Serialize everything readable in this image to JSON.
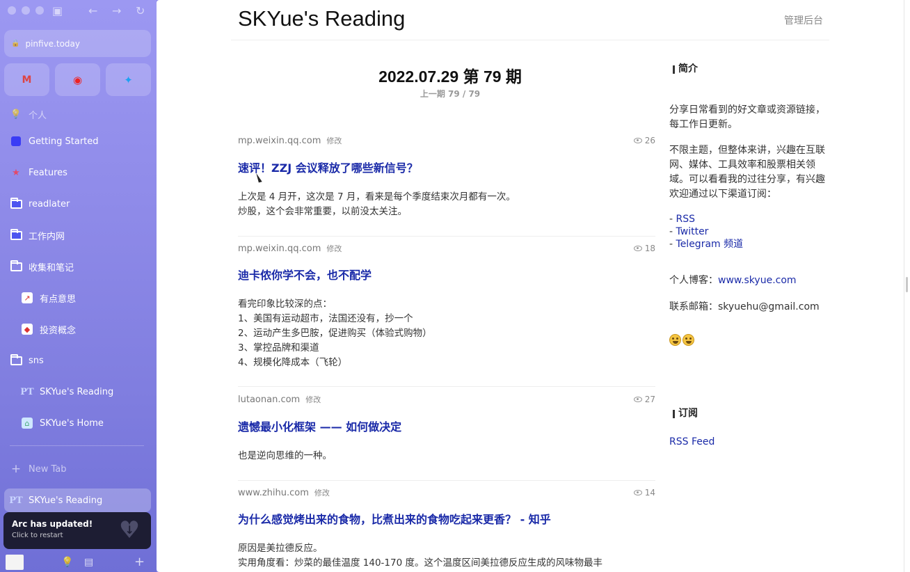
{
  "browser": {
    "url": "pinfive.today",
    "favorites": [
      "gmail-icon",
      "weibo-icon",
      "twitter-icon"
    ],
    "sidebar_section_label": "个人",
    "sidebar_items": [
      {
        "label": "Getting Started",
        "icon": "blue-square-icon"
      },
      {
        "label": "Features",
        "icon": "star-icon"
      },
      {
        "label": "readlater",
        "icon": "folder-icon"
      },
      {
        "label": "工作内网",
        "icon": "folder-icon"
      },
      {
        "label": "收集和笔记",
        "icon": "open-folder-icon"
      },
      {
        "label": "有点意思",
        "icon": "app-icon"
      },
      {
        "label": "投资概念",
        "icon": "app-icon"
      },
      {
        "label": "sns",
        "icon": "open-folder-icon"
      },
      {
        "label": "SKYue's Reading",
        "icon": "pt-icon"
      },
      {
        "label": "SKYue's Home",
        "icon": "app-icon"
      }
    ],
    "new_tab_label": "New Tab",
    "active_tab_label": "SKYue's Reading",
    "update_title": "Arc has updated!",
    "update_subtitle": "Click to restart",
    "accent_color": "#8a86e8"
  },
  "site": {
    "title": "SKYue's Reading",
    "admin_link": "管理后台",
    "issue_title": "2022.07.29 第 79 期",
    "issue_nav": "上一期 79 / 79"
  },
  "articles": [
    {
      "domain": "mp.weixin.qq.com",
      "edit": "修改",
      "views": "26",
      "title": "速评！ZZJ 会议释放了哪些新信号？",
      "body": [
        "上次是 4 月开，这次是 7 月，看来是每个季度结束次月都有一次。",
        "炒股，这个会非常重要，以前没太关注。"
      ]
    },
    {
      "domain": "mp.weixin.qq.com",
      "edit": "修改",
      "views": "18",
      "title": "迪卡侬你学不会，也不配学",
      "body": [
        "看完印象比较深的点：",
        "1、美国有运动超市，法国还没有，抄一个",
        "2、运动产生多巴胺，促进购买（体验式购物）",
        "3、掌控品牌和渠道",
        "4、规模化降成本（飞轮）"
      ]
    },
    {
      "domain": "lutaonan.com",
      "edit": "修改",
      "views": "27",
      "title": "遗憾最小化框架 —— 如何做决定",
      "body": [
        "也是逆向思维的一种。"
      ]
    },
    {
      "domain": "www.zhihu.com",
      "edit": "修改",
      "views": "14",
      "title": "为什么感觉烤出来的食物，比煮出来的食物吃起来更香？ - 知乎",
      "body": [
        "原因是美拉德反应。",
        "实用角度看：炒菜的最佳温度 140-170 度。这个温度区间美拉德反应生成的风味物最丰"
      ]
    }
  ],
  "sidebar_right": {
    "intro_heading": "简介",
    "intro_p1": "分享日常看到的好文章或资源链接，每工作日更新。",
    "intro_p2": "不限主题，但整体来讲，兴趣在互联网、媒体、工具效率和股票相关领域。可以看看我的过往分享，有兴趣欢迎通过以下渠道订阅：",
    "channels": [
      {
        "prefix": "- ",
        "label": "RSS"
      },
      {
        "prefix": "- ",
        "label": "Twitter"
      },
      {
        "prefix": "- ",
        "label": "Telegram 频道"
      }
    ],
    "blog_label": "个人博客：",
    "blog_link": "www.skyue.com",
    "email_label": "联系邮箱：",
    "email": "skyuehu@gmail.com",
    "emoji": "grinning-face-emoji",
    "subscribe_heading": "订阅",
    "rss_feed": "RSS Feed"
  }
}
